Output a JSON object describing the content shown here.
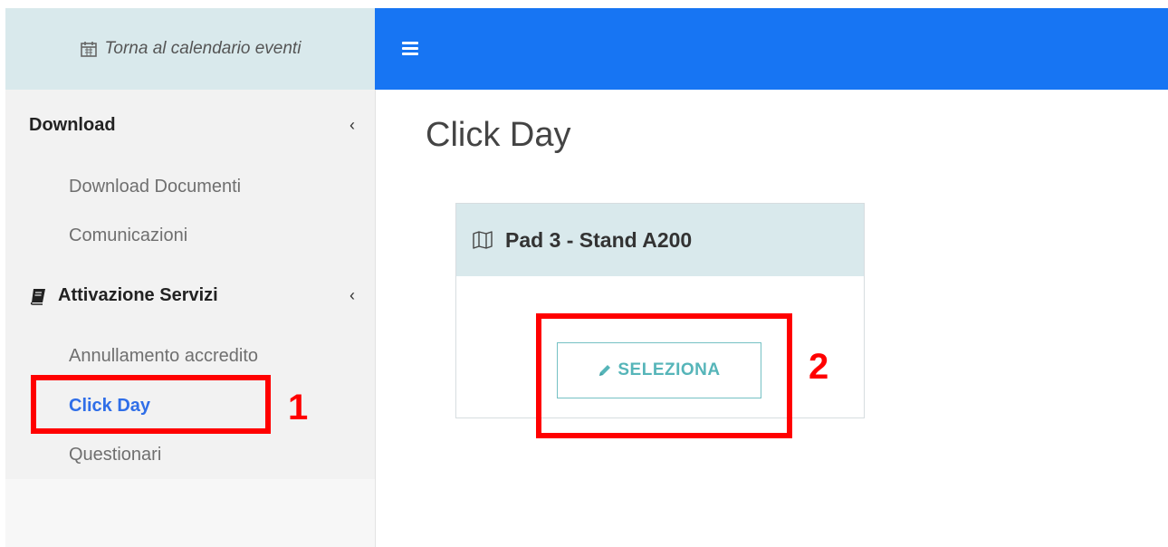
{
  "sidebar": {
    "back_link": "Torna al calendario eventi",
    "sections": [
      {
        "label": "Download",
        "chevron": "‹"
      },
      {
        "label": "Attivazione Servizi",
        "chevron": "‹"
      }
    ],
    "download_items": [
      "Download Documenti",
      "Comunicazioni"
    ],
    "servizi_items": [
      "Annullamento accredito",
      "Click Day",
      "Questionari"
    ]
  },
  "main": {
    "title": "Click Day",
    "card": {
      "title": "Pad 3 - Stand A200",
      "button_label": "SELEZIONA"
    }
  },
  "annotations": {
    "label_1": "1",
    "label_2": "2"
  },
  "colors": {
    "topbar": "#1775f3",
    "highlight": "#ff0000",
    "active_link": "#2f6ee8",
    "button_teal": "#56b5b9"
  }
}
